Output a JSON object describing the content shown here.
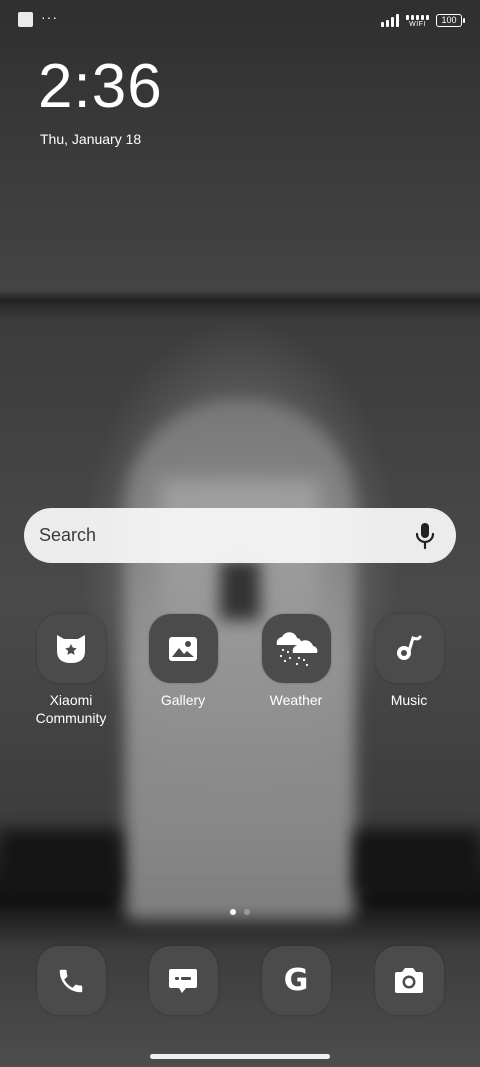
{
  "status_bar": {
    "more": "···",
    "wifi": "WIFI",
    "battery": "100"
  },
  "clock": {
    "time": "2:36",
    "date": "Thu, January 18"
  },
  "search": {
    "placeholder": "Search"
  },
  "apps": [
    {
      "label": "Xiaomi\nCommunity",
      "icon": "xiaomi-community-icon"
    },
    {
      "label": "Gallery",
      "icon": "gallery-icon"
    },
    {
      "label": "Weather",
      "icon": "weather-icon"
    },
    {
      "label": "Music",
      "icon": "music-icon"
    }
  ],
  "dock": [
    {
      "icon": "phone-icon"
    },
    {
      "icon": "messages-icon"
    },
    {
      "icon": "google-icon",
      "glyph": "G"
    },
    {
      "icon": "camera-icon"
    }
  ],
  "pages": {
    "current": 1,
    "total": 2
  }
}
